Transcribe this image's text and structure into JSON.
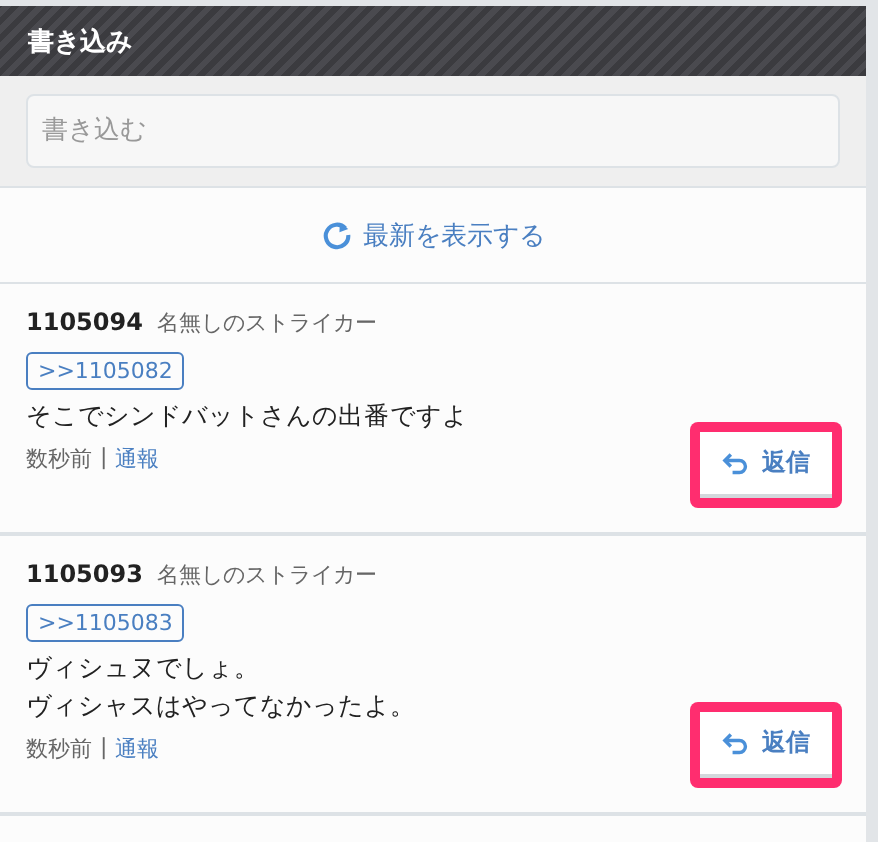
{
  "header": {
    "title": "書き込み"
  },
  "compose": {
    "placeholder": "書き込む"
  },
  "refresh": {
    "label": "最新を表示する"
  },
  "posts": [
    {
      "number": "1105094",
      "author": "名無しのストライカー",
      "anchor": ">>1105082",
      "message": [
        "そこでシンドバットさんの出番ですよ"
      ],
      "time": "数秒前",
      "separator": "|",
      "report": "通報",
      "reply": "返信",
      "highlighted": true
    },
    {
      "number": "1105093",
      "author": "名無しのストライカー",
      "anchor": ">>1105083",
      "message": [
        "ヴィシュヌでしょ。",
        "ヴィシャスはやってなかったよ。"
      ],
      "time": "数秒前",
      "separator": "|",
      "report": "通報",
      "reply": "返信",
      "highlighted": true
    }
  ]
}
